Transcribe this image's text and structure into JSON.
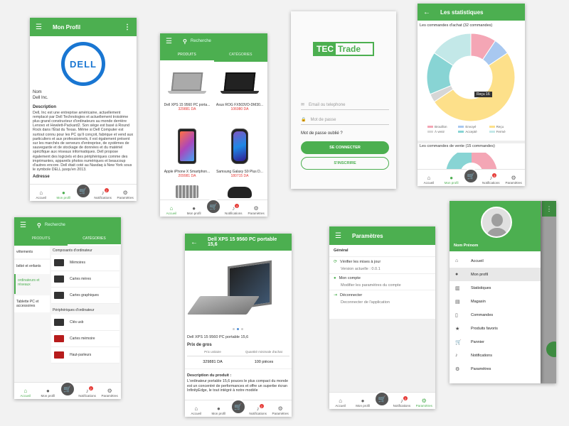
{
  "nav": {
    "accueil": "Accueil",
    "profil": "Mon profil",
    "notifications": "Notifications",
    "parametres": "Paramètres",
    "badge": "2"
  },
  "profile": {
    "title": "Mon Profil",
    "logo": "DELL",
    "nom_label": "Nom",
    "nom_value": "Dell Inc.",
    "description_label": "Description",
    "description_text": "Dell, Inc est une entreprise américaine, actuellement remplacé par Dell Technologies et actuellement troisième plus grand constructeur d'ordinateurs au monde derrière Lenovo et Hewlett-Packard2. Son siège est basé à Round Rock dans l'État du Texas. Même si Dell Computer est surtout connu pour les PC qu'il conçoit, fabrique et vend aux particuliers et aux professionnels, il est également présent sur les marchés de serveurs d'entreprise, de systèmes de sauvegarde et de stockage de données et du matériel spécifique aux réseaux informatiques. Dell propose également des logiciels et des périphériques comme des imprimantes, appareils photos numériques et beaucoup d'autres encore. Dell était coté au Nasdaq à New York sous le symbole DELL jusqu'en 2013.",
    "adresse_label": "Adresse"
  },
  "products": {
    "search_placeholder": "Recherche",
    "tab_products": "PRODUITS",
    "tab_categories": "CATÉGORIES",
    "items": [
      {
        "name": "Dell XPS 15 9560 PC porta...",
        "price": "329881 DA"
      },
      {
        "name": "Asus ROG FX503VD-DM30...",
        "price": "106980 DA"
      },
      {
        "name": "Apple iPhone X Smartphon...",
        "price": "209981 DA"
      },
      {
        "name": "Samsung Galaxy S9 Plus D...",
        "price": "180715 DA"
      }
    ]
  },
  "login": {
    "logo_left": "TEC",
    "logo_right": "Trade",
    "email_placeholder": "Email ou telephone",
    "password_placeholder": "Mot de passe",
    "forgot": "Mot de passe oublié ?",
    "connect": "SE CONNECTER",
    "register": "S'INSCRIRE"
  },
  "stats": {
    "title": "Les statistiques",
    "achat_title": "Les commandes d'achat (32 commandes)",
    "tooltip": "Reçu 16",
    "legend": [
      "Brouillon",
      "Envoyé",
      "Reçu",
      "À venir",
      "Accepté",
      "Fermé"
    ],
    "vente_title": "Les commandes de vente (15 commandes)"
  },
  "chart_data": {
    "type": "pie",
    "title": "Les commandes d'achat (32 commandes)",
    "categories": [
      "Brouillon",
      "Envoyé",
      "Reçu",
      "À venir",
      "Accepté",
      "Fermé"
    ],
    "values": [
      3,
      2,
      16,
      1,
      5,
      5
    ],
    "colors": [
      "#f4a6b5",
      "#a8c8f0",
      "#fde08a",
      "#d6d6d6",
      "#88d4d4",
      "#c3e8e8"
    ]
  },
  "categories": {
    "search_placeholder": "Recherche",
    "tab_products": "PRODUITS",
    "tab_categories": "CATÉGORIES",
    "left": [
      "vêtements",
      "bébé et enfants",
      "ordinateurs et réseaux",
      "Tablette PC et accessoires"
    ],
    "group1": "Composants d'ordinateur",
    "sub1": [
      "Mémoires",
      "Cartes mères",
      "Cartes graphiques"
    ],
    "group2": "Périphériques d'ordinateur",
    "sub2": [
      "Clés usb",
      "Cartes mémoire",
      "Haut-parleurs"
    ]
  },
  "detail": {
    "title": "Dell XPS 15 9560 PC portable 15,6",
    "name": "Dell XPS 15 9560 PC portable 15,6",
    "prix_gros": "Prix de gros",
    "col1": "Prix unitaire",
    "col2": "Quantité minimale d'achat",
    "val1": "329881 DA",
    "val2": "100 pièces",
    "desc_label": "Description du produit :",
    "desc_text": "L'ordinateur portable 15,6 pouces le plus compact du monde est un concentré de performances et offre un superbe écran InfinityEdge, le tout intégré à notre modèle"
  },
  "settings": {
    "title": "Paramètres",
    "section": "Général",
    "update": "Vérifier les mises à jour",
    "version": "Version actuelle : 0.0.1",
    "account": "Mon compte",
    "account_sub": "Modifier les paramètres du compte",
    "logout": "Déconnecter",
    "logout_sub": "Deconnecter de l'application"
  },
  "drawer": {
    "user": "Nom Prénom",
    "items": [
      "Accueil",
      "Mon profil",
      "Statistiques",
      "Magasin",
      "Commandes",
      "Produits favoris",
      "Pannier",
      "Notifications",
      "Paramètres"
    ]
  }
}
